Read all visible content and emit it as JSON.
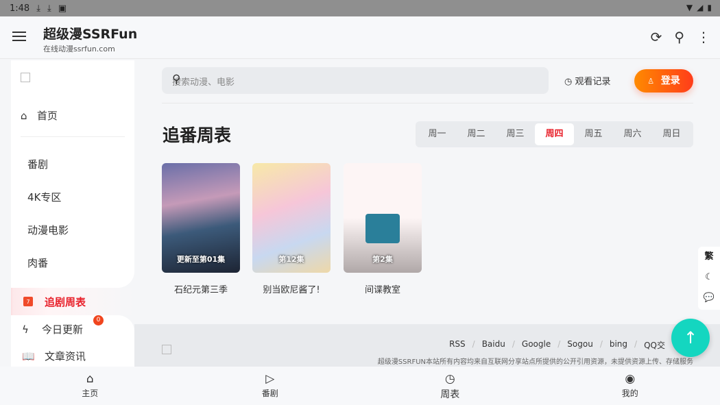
{
  "status": {
    "time": "1:48"
  },
  "appbar": {
    "title": "超级漫SSRFun",
    "subtitle": "在线动漫ssrfun.com"
  },
  "sidebar": {
    "items": [
      {
        "label": "首页"
      },
      {
        "label": "番剧"
      },
      {
        "label": "4K专区"
      },
      {
        "label": "动漫电影"
      },
      {
        "label": "肉番"
      },
      {
        "label": "追剧周表"
      },
      {
        "label": "今日更新",
        "badge": "0"
      },
      {
        "label": "文章资讯"
      }
    ]
  },
  "search": {
    "placeholder": "搜索动漫、电影"
  },
  "header": {
    "history": "观看记录",
    "login": "登录"
  },
  "schedule": {
    "title": "追番周表",
    "days": [
      "周一",
      "周二",
      "周三",
      "周四",
      "周五",
      "周六",
      "周日"
    ],
    "selected": "周四",
    "items": [
      {
        "title": "石纪元第三季",
        "episode": "更新至第01集"
      },
      {
        "title": "别当欧尼酱了!",
        "episode": "第12集"
      },
      {
        "title": "间谍教室",
        "episode": "第2集"
      }
    ]
  },
  "footer": {
    "links": [
      "RSS",
      "Baidu",
      "Google",
      "Sogou",
      "bing",
      "QQ交"
    ],
    "note": "超级漫SSRFUN本站所有内容均来自互联网分享站点所提供的公开引用资源，未提供资源上传、存储服务"
  },
  "float": {
    "traditional": "繁"
  },
  "bottom_nav": [
    {
      "label": "主页"
    },
    {
      "label": "番剧"
    },
    {
      "label": "周表"
    },
    {
      "label": "我的"
    }
  ],
  "colors": {
    "accent": "#e8202a",
    "fab": "#14d6c0",
    "login_start": "#ff8a00",
    "login_end": "#ff3d1a"
  }
}
